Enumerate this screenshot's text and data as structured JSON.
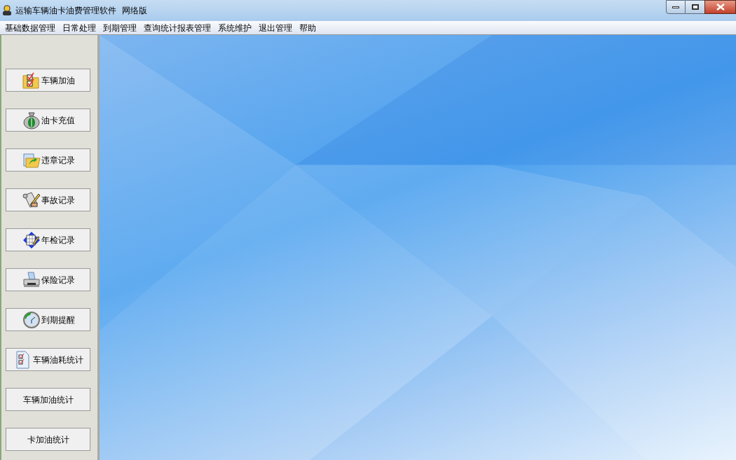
{
  "window": {
    "title": "运输车辆油卡油费管理软件  网络版"
  },
  "menu": [
    {
      "label": "基础数据管理"
    },
    {
      "label": "日常处理"
    },
    {
      "label": "到期管理"
    },
    {
      "label": "查询统计报表管理"
    },
    {
      "label": "系统维护"
    },
    {
      "label": "退出管理"
    },
    {
      "label": "帮助"
    }
  ],
  "sidebar": {
    "buttons": [
      {
        "label": "车辆加油",
        "kind": "checklist"
      },
      {
        "label": "油卡充值",
        "kind": "moneybag"
      },
      {
        "label": "违章记录",
        "kind": "folder"
      },
      {
        "label": "事故记录",
        "kind": "scroll"
      },
      {
        "label": "年检记录",
        "kind": "diamond"
      },
      {
        "label": "保险记录",
        "kind": "printer"
      },
      {
        "label": "到期提醒",
        "kind": "clock"
      },
      {
        "label": "车辆油耗统计",
        "kind": "document"
      },
      {
        "label": "车辆加油统计",
        "kind": "plain"
      },
      {
        "label": "卡加油统计",
        "kind": "plain"
      }
    ]
  }
}
